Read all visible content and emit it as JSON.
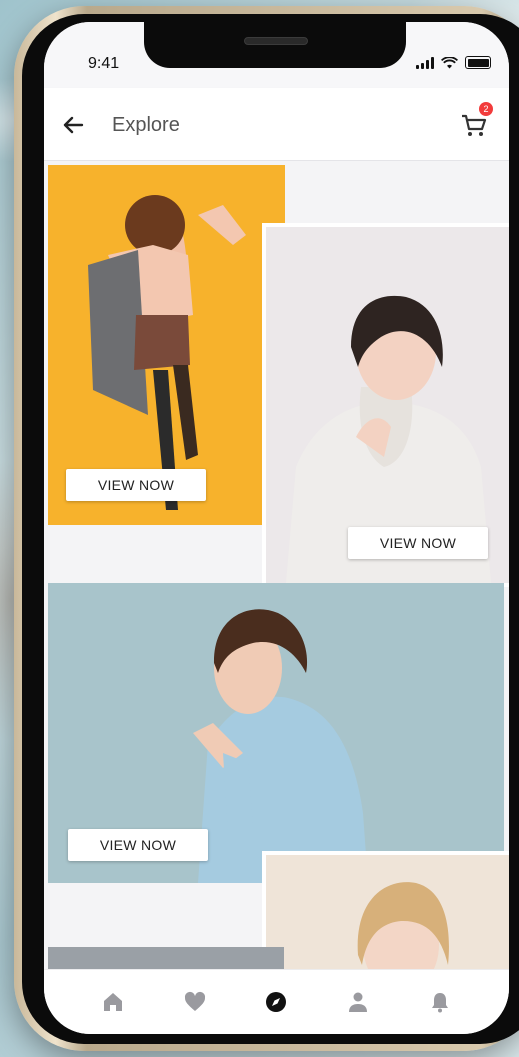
{
  "status_bar": {
    "time": "9:41"
  },
  "header": {
    "title": "Explore",
    "cart_count": "2"
  },
  "feed": {
    "cards": [
      {
        "button_label": "VIEW NOW"
      },
      {
        "button_label": "VIEW NOW"
      },
      {
        "button_label": "VIEW NOW"
      },
      {
        "button_label": ""
      },
      {
        "button_label": ""
      }
    ]
  },
  "bottom_nav": {
    "items": [
      {
        "icon": "home-icon",
        "active": false
      },
      {
        "icon": "heart-icon",
        "active": false
      },
      {
        "icon": "compass-icon",
        "active": true
      },
      {
        "icon": "user-icon",
        "active": false
      },
      {
        "icon": "bell-icon",
        "active": false
      }
    ]
  },
  "colors": {
    "active_nav": "#111111",
    "inactive_nav": "#9a9a9f",
    "badge": "#f23b3b"
  }
}
